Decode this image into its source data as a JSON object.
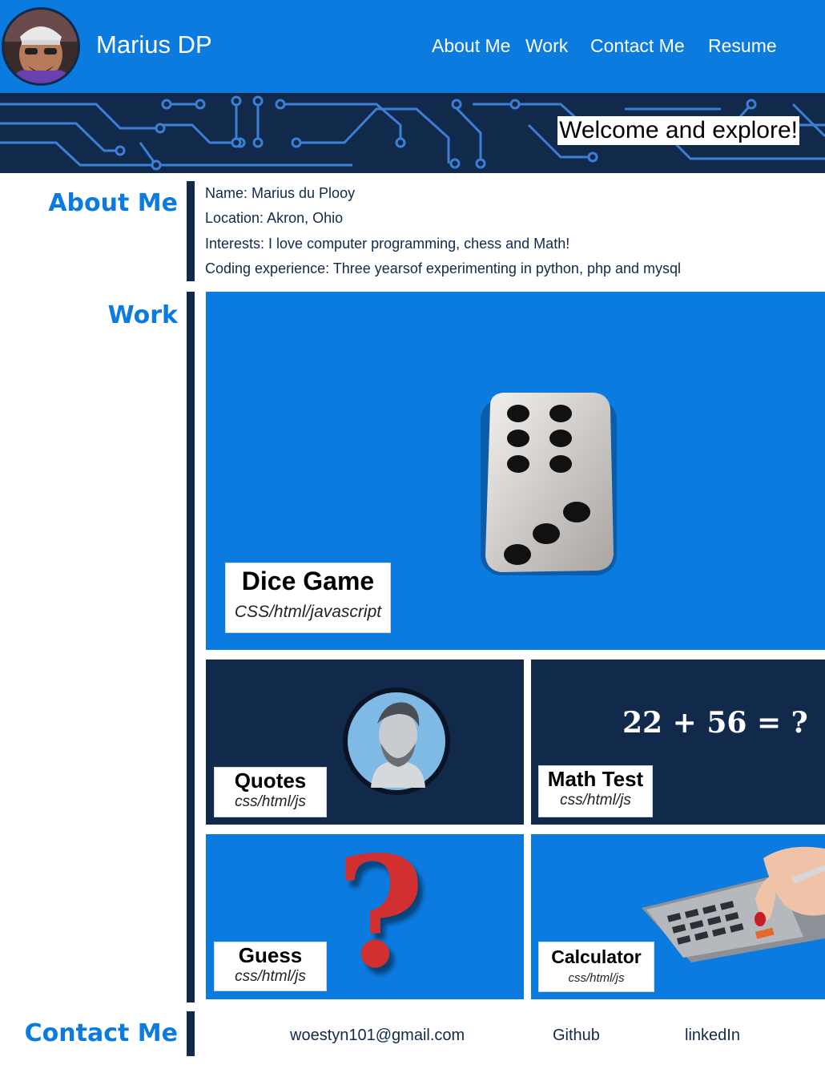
{
  "header": {
    "brand": "Marius DP",
    "nav": [
      "About Me",
      "Work",
      "Contact Me",
      "Resume"
    ]
  },
  "banner": {
    "welcome": "Welcome and explore!"
  },
  "about": {
    "title": "About Me",
    "lines": [
      "Name: Marius du Plooy",
      "Location: Akron, Ohio",
      "Interests: I love computer programming, chess and Math!",
      "Coding experience: Three yearsof experimenting in python, php and mysql"
    ]
  },
  "work": {
    "title": "Work",
    "projects": [
      {
        "title": "Dice Game",
        "tech": "CSS/html/javascript"
      },
      {
        "title": "Quotes",
        "tech": "css/html/js"
      },
      {
        "title": "Math Test",
        "tech": "css/html/js",
        "equation": "22 + 56 = ?"
      },
      {
        "title": "Guess",
        "tech": "css/html/js",
        "glyph": "?"
      },
      {
        "title": "Calculator",
        "tech": "css/html/js"
      }
    ]
  },
  "contact": {
    "title": "Contact Me",
    "email": "woestyn101@gmail.com",
    "github": "Github",
    "linkedin": "linkedIn"
  },
  "colors": {
    "primary": "#0b7be0",
    "navy": "#112a4b",
    "circuit": "#3b7fd6"
  }
}
